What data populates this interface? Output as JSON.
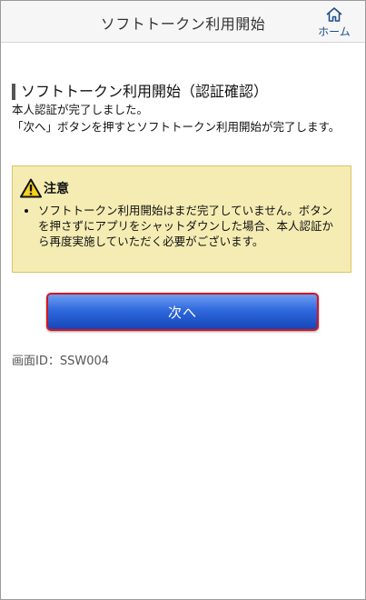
{
  "header": {
    "title": "ソフトトークン利用開始",
    "home_label": "ホーム"
  },
  "main": {
    "section_title": "ソフトトークン利用開始（認証確認）",
    "line1": "本人認証が完了しました。",
    "line2": "「次へ」ボタンを押すとソフトトークン利用開始が完了します。"
  },
  "notice": {
    "title": "注意",
    "items": [
      "ソフトトークン利用開始はまだ完了していません。ボタンを押さずにアプリをシャットダウンした場合、本人認証から再度実施していただく必要がございます。"
    ]
  },
  "actions": {
    "next_label": "次へ"
  },
  "footer": {
    "screen_id": "画面ID：SSW004"
  },
  "icons": {
    "home": "home-icon",
    "warning": "warning-icon"
  },
  "colors": {
    "button_top": "#6f9cf0",
    "button_bottom": "#1646b9",
    "highlight_border": "#d8141f",
    "notice_bg": "#f5ecb3",
    "home_label": "#1f4f8a"
  }
}
